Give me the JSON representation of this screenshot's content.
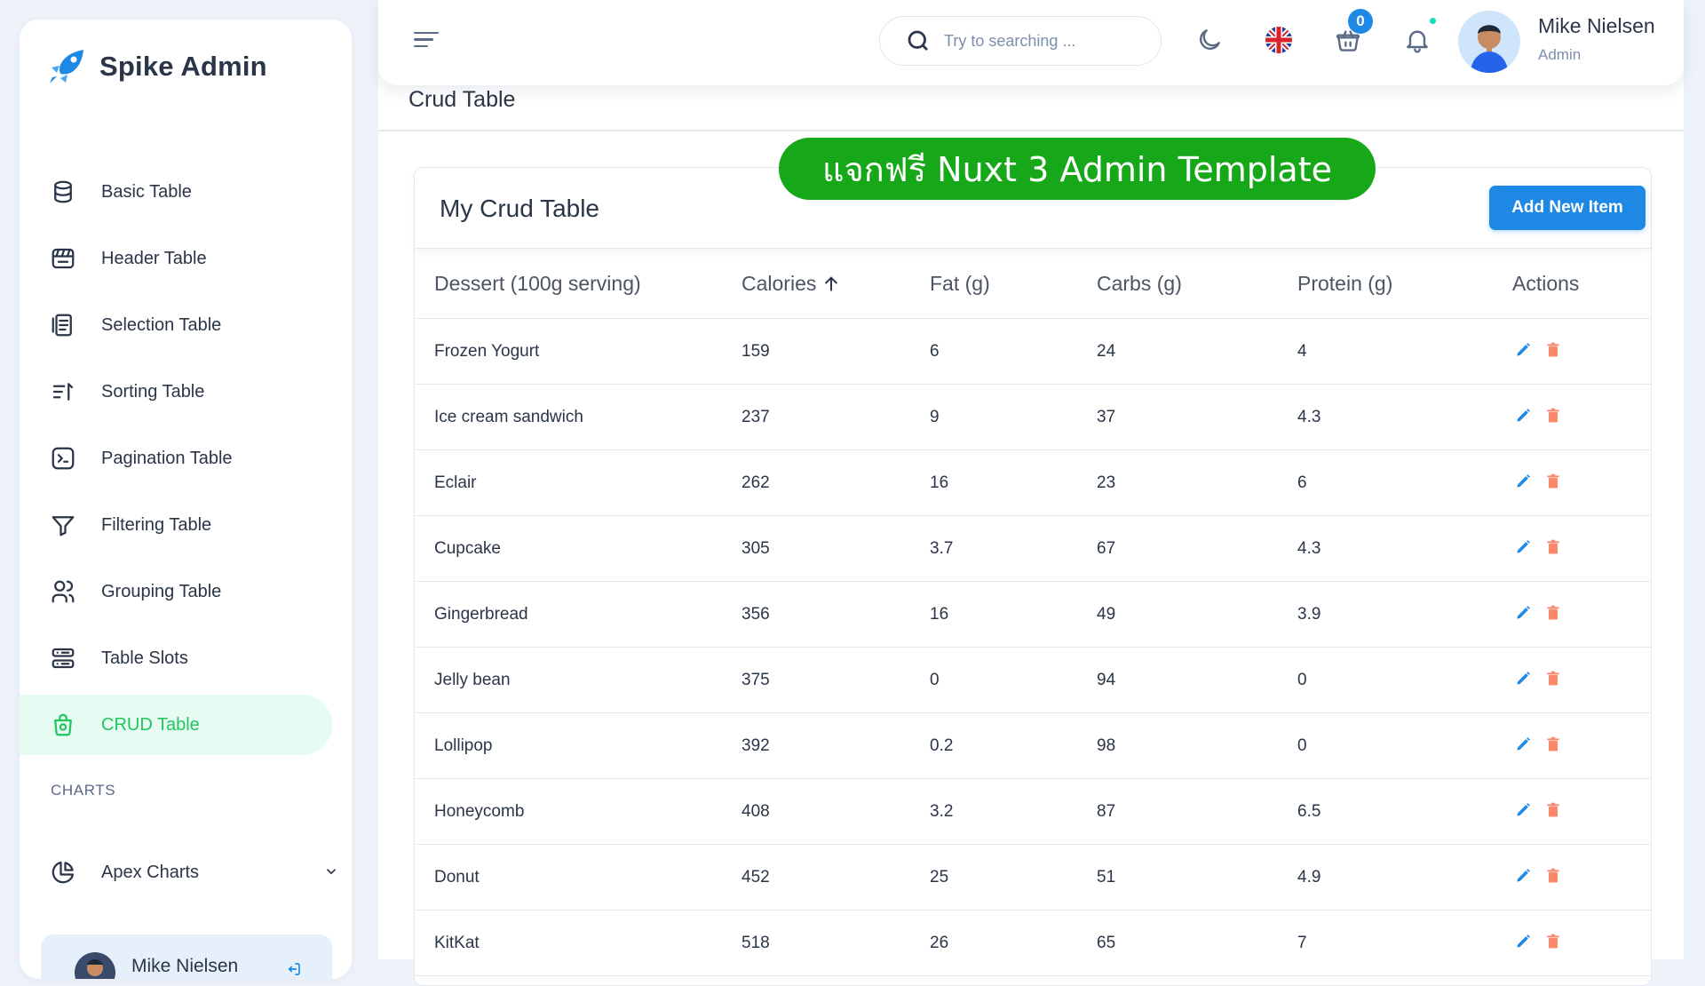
{
  "brand": {
    "name": "Spike Admin"
  },
  "sidebar": {
    "items": [
      {
        "label": "Basic Table",
        "icon": "database-icon"
      },
      {
        "label": "Header Table",
        "icon": "header-table-icon"
      },
      {
        "label": "Selection Table",
        "icon": "selection-table-icon"
      },
      {
        "label": "Sorting Table",
        "icon": "sort-icon"
      },
      {
        "label": "Pagination Table",
        "icon": "terminal-icon"
      },
      {
        "label": "Filtering Table",
        "icon": "filter-icon"
      },
      {
        "label": "Grouping Table",
        "icon": "users-group-icon"
      },
      {
        "label": "Table Slots",
        "icon": "server-icon"
      },
      {
        "label": "CRUD Table",
        "icon": "basket-icon",
        "active": true
      }
    ],
    "section_caption": "CHARTS",
    "charts_item": {
      "label": "Apex Charts",
      "icon": "chart-pie-icon"
    },
    "profile": {
      "name": "Mike Nielsen"
    }
  },
  "topbar": {
    "search_placeholder": "Try to searching ...",
    "cart_count": "0",
    "user_name": "Mike Nielsen",
    "user_role": "Admin"
  },
  "page": {
    "title": "Crud Table"
  },
  "promo": {
    "text": "แจกฟรี Nuxt 3 Admin Template"
  },
  "card": {
    "title": "My Crud Table",
    "add_button": "Add New Item",
    "columns": [
      "Dessert (100g serving)",
      "Calories",
      "Fat (g)",
      "Carbs (g)",
      "Protein (g)",
      "Actions"
    ],
    "rows": [
      [
        "Frozen Yogurt",
        "159",
        "6",
        "24",
        "4"
      ],
      [
        "Ice cream sandwich",
        "237",
        "9",
        "37",
        "4.3"
      ],
      [
        "Eclair",
        "262",
        "16",
        "23",
        "6"
      ],
      [
        "Cupcake",
        "305",
        "3.7",
        "67",
        "4.3"
      ],
      [
        "Gingerbread",
        "356",
        "16",
        "49",
        "3.9"
      ],
      [
        "Jelly bean",
        "375",
        "0",
        "94",
        "0"
      ],
      [
        "Lollipop",
        "392",
        "0.2",
        "98",
        "0"
      ],
      [
        "Honeycomb",
        "408",
        "3.2",
        "87",
        "6.5"
      ],
      [
        "Donut",
        "452",
        "25",
        "51",
        "4.9"
      ],
      [
        "KitKat",
        "518",
        "26",
        "65",
        "7"
      ]
    ]
  },
  "colors": {
    "primary": "#1e88e5",
    "active_green": "#22c55e",
    "active_bg": "#e6fbf1",
    "promo_green": "#17a81a",
    "delete_red": "#fa896b"
  }
}
